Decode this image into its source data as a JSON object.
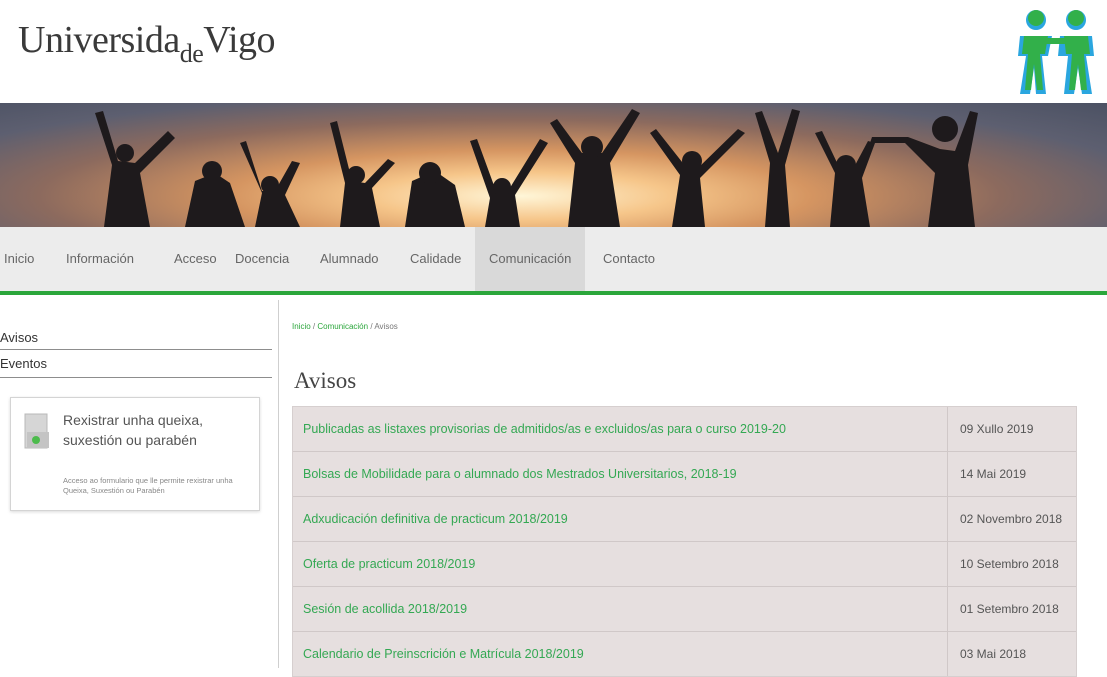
{
  "header": {
    "logo": {
      "part1": "Universida",
      "part2": "de",
      "part3": "Vigo"
    }
  },
  "nav": {
    "items": [
      {
        "label": "Inicio"
      },
      {
        "label": "Información"
      },
      {
        "label": "Acceso"
      },
      {
        "label": "Docencia"
      },
      {
        "label": "Alumnado"
      },
      {
        "label": "Calidade"
      },
      {
        "label": "Comunicación",
        "active": true
      },
      {
        "label": "Contacto"
      }
    ]
  },
  "sidebar": {
    "items": [
      {
        "label": "Avisos"
      },
      {
        "label": "Eventos"
      }
    ],
    "complaint": {
      "title": "Rexistrar unha queixa, suxestión ou parabén",
      "description": "Acceso ao formulario que lle permite rexistrar unha Queixa, Suxestión ou Parabén"
    }
  },
  "breadcrumb": {
    "home": "Inicio",
    "section": "Comunicación",
    "current": "Avisos",
    "separator": "/"
  },
  "page_title": "Avisos",
  "notices": [
    {
      "title": "Publicadas as listaxes provisorias de admitidos/as e excluidos/as para o curso 2019-20",
      "date": "09 Xullo 2019"
    },
    {
      "title": "Bolsas de Mobilidade para o alumnado dos Mestrados Universitarios, 2018-19",
      "date": "14 Mai 2019"
    },
    {
      "title": "Adxudicación definitiva de practicum 2018/2019",
      "date": "02 Novembro 2018"
    },
    {
      "title": "Oferta de practicum 2018/2019",
      "date": "10 Setembro 2018"
    },
    {
      "title": "Sesión de acollida 2018/2019",
      "date": "01 Setembro 2018"
    },
    {
      "title": "Calendario de Preinscrición e Matrícula 2018/2019",
      "date": "03 Mai 2018"
    }
  ],
  "colors": {
    "accent": "#2ba63b",
    "link": "#34a853",
    "row_bg": "#e6dfdf",
    "brand_icon_green": "#32b04a",
    "brand_icon_blue": "#2aa6df"
  }
}
